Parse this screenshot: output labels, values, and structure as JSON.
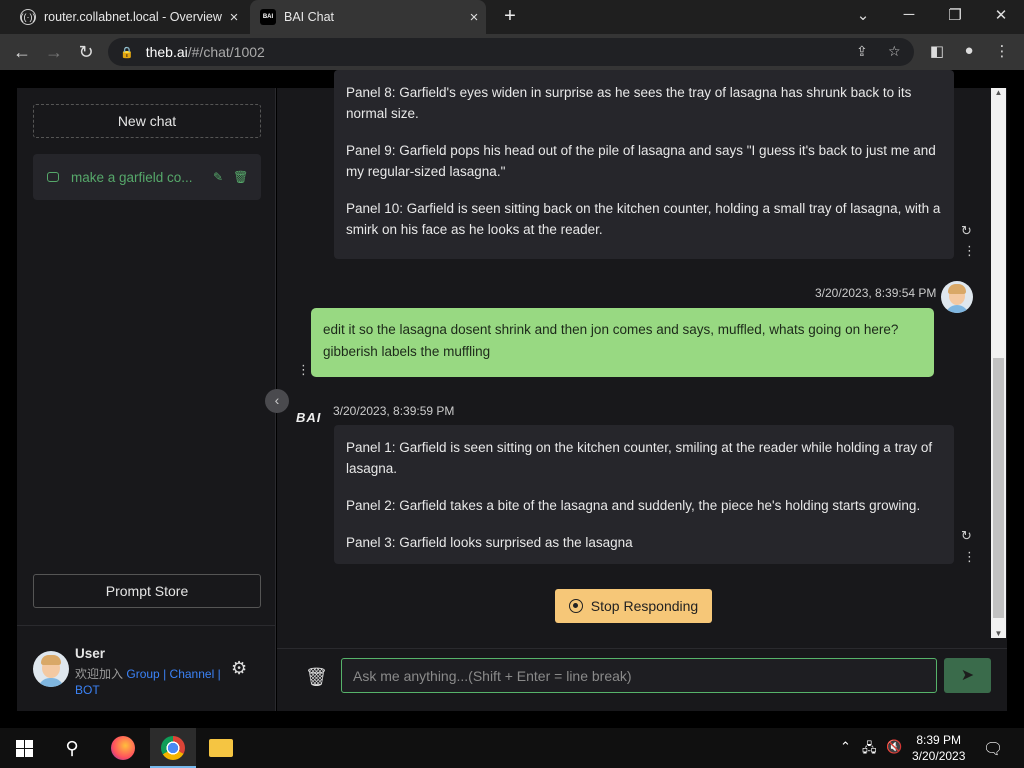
{
  "browser": {
    "tabs": [
      {
        "title": "router.collabnet.local - Overview",
        "close": "×"
      },
      {
        "title": "BAI Chat",
        "close": "×",
        "favicon_text": "BAI"
      }
    ],
    "new_tab": "+",
    "window_controls": {
      "minimize": "─",
      "restore": "❐",
      "close": "✕",
      "dropdown": "⌄"
    },
    "address": {
      "host": "theb.ai",
      "path": "/#/chat/1002"
    }
  },
  "sidebar": {
    "new_chat_label": "New chat",
    "chats": [
      {
        "title": "make a garfield co..."
      }
    ],
    "prompt_store_label": "Prompt Store",
    "user": {
      "name": "User",
      "join_text": "欢迎加入",
      "links": [
        "Group",
        "Channel",
        "BOT"
      ]
    }
  },
  "messages": [
    {
      "role": "assistant",
      "paragraphs": [
        "Panel 8: Garfield's eyes widen in surprise as he sees the tray of lasagna has shrunk back to its normal size.",
        "Panel 9: Garfield pops his head out of the pile of lasagna and says \"I guess it's back to just me and my regular-sized lasagna.\"",
        "Panel 10: Garfield is seen sitting back on the kitchen counter, holding a small tray of lasagna, with a smirk on his face as he looks at the reader."
      ]
    },
    {
      "role": "user",
      "timestamp": "3/20/2023, 8:39:54 PM",
      "text": "edit it so the lasagna dosent shrink and then jon comes and says, muffled, whats going on here? gibberish labels the muffling"
    },
    {
      "role": "assistant",
      "author": "BAI",
      "timestamp": "3/20/2023, 8:39:59 PM",
      "paragraphs": [
        "Panel 1: Garfield is seen sitting on the kitchen counter, smiling at the reader while holding a tray of lasagna.",
        "Panel 2: Garfield takes a bite of the lasagna and suddenly, the piece he's holding starts growing.",
        "Panel 3: Garfield looks surprised as the lasagna"
      ]
    }
  ],
  "stop_button_label": "Stop Responding",
  "input": {
    "placeholder": "Ask me anything...(Shift + Enter = line break)",
    "value": ""
  },
  "taskbar": {
    "time": "8:39 PM",
    "date": "3/20/2023"
  },
  "colors": {
    "user_bubble": "#98d982",
    "accent": "#56b36a",
    "stop_button": "#f6c778"
  }
}
